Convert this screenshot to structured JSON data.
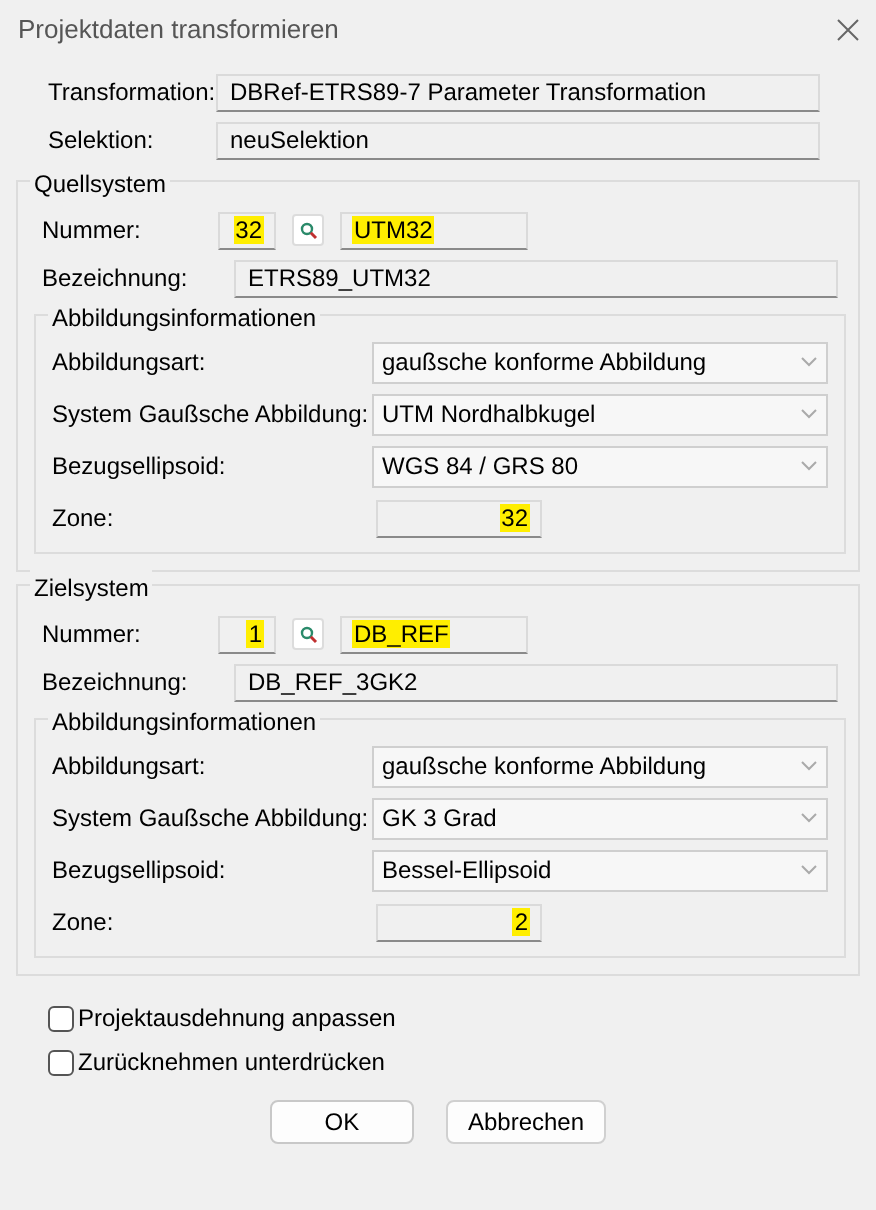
{
  "window": {
    "title": "Projektdaten transformieren"
  },
  "fields": [
    {
      "label": "Transformation:",
      "value": "DBRef-ETRS89-7 Parameter Transformation"
    },
    {
      "label": "Selektion:",
      "value": "neuSelektion"
    }
  ],
  "systems": [
    {
      "title": "Quellsystem",
      "number": {
        "label": "Nummer:",
        "value": "32",
        "highlighted": true
      },
      "code": {
        "value": "UTM32",
        "highlighted": true
      },
      "designation": {
        "label": "Bezeichnung:",
        "value": "ETRS89_UTM32"
      },
      "projection": {
        "title": "Abbildungsinformationen",
        "dropdowns": [
          {
            "label": "Abbildungsart:",
            "value": "gaußsche konforme Abbildung"
          },
          {
            "label": "System Gaußsche Abbildung:",
            "value": "UTM Nordhalbkugel"
          },
          {
            "label": "Bezugsellipsoid:",
            "value": "WGS 84 / GRS 80"
          }
        ],
        "zone": {
          "label": "Zone:",
          "value": "32",
          "highlighted": true
        }
      }
    },
    {
      "title": "Zielsystem",
      "number": {
        "label": "Nummer:",
        "value": "1",
        "highlighted": true
      },
      "code": {
        "value": "DB_REF",
        "highlighted": true
      },
      "designation": {
        "label": "Bezeichnung:",
        "value": "DB_REF_3GK2"
      },
      "projection": {
        "title": "Abbildungsinformationen",
        "dropdowns": [
          {
            "label": "Abbildungsart:",
            "value": "gaußsche konforme Abbildung"
          },
          {
            "label": "System Gaußsche Abbildung:",
            "value": "GK 3 Grad"
          },
          {
            "label": "Bezugsellipsoid:",
            "value": "Bessel-Ellipsoid"
          }
        ],
        "zone": {
          "label": "Zone:",
          "value": "2",
          "highlighted": true
        }
      }
    }
  ],
  "checkboxes": [
    {
      "label": "Projektausdehnung anpassen",
      "checked": false
    },
    {
      "label": "Zurücknehmen unterdrücken",
      "checked": false
    }
  ],
  "buttons": [
    {
      "label": "OK",
      "kind": "default"
    },
    {
      "label": "Abbrechen",
      "kind": "normal"
    }
  ]
}
